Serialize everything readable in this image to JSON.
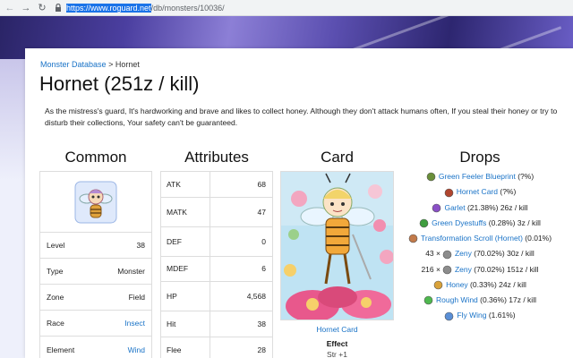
{
  "browser": {
    "url_selected": "https://www.roguard.net",
    "url_rest": "/db/monsters/10036/"
  },
  "breadcrumb": {
    "parent": "Monster Database",
    "separator": ">",
    "current": "Hornet"
  },
  "title": "Hornet (251z / kill)",
  "description": "As the mistress's guard, It's hardworking and brave and likes to collect honey. Although they don't attack humans often, If you steal their honey or try to disturb their collections, Your safety can't be guaranteed.",
  "headers": {
    "common": "Common",
    "attributes": "Attributes",
    "card": "Card",
    "drops": "Drops"
  },
  "common": [
    {
      "label": "Level",
      "value": "38",
      "link": false
    },
    {
      "label": "Type",
      "value": "Monster",
      "link": false
    },
    {
      "label": "Zone",
      "value": "Field",
      "link": false
    },
    {
      "label": "Race",
      "value": "Insect",
      "link": true
    },
    {
      "label": "Element",
      "value": "Wind",
      "link": true
    }
  ],
  "attributes": [
    {
      "label": "ATK",
      "value": "68"
    },
    {
      "label": "MATK",
      "value": "47"
    },
    {
      "label": "DEF",
      "value": "0"
    },
    {
      "label": "MDEF",
      "value": "6"
    },
    {
      "label": "HP",
      "value": "4,568"
    },
    {
      "label": "Hit",
      "value": "38"
    },
    {
      "label": "Flee",
      "value": "28"
    }
  ],
  "card": {
    "name": "Hornet Card",
    "effect_label": "Effect",
    "effect_value": "Str +1"
  },
  "drops": [
    {
      "prefix": "",
      "name": "Green Feeler Blueprint",
      "suffix": " (?%)",
      "icon": "blueprint-icon",
      "color": "#6a8f3a"
    },
    {
      "prefix": "",
      "name": "Hornet Card",
      "suffix": " (?%)",
      "icon": "card-icon",
      "color": "#b0452e"
    },
    {
      "prefix": "",
      "name": "Garlet",
      "suffix": " (21.38%) 26z / kill",
      "icon": "garlet-icon",
      "color": "#8a4fc6"
    },
    {
      "prefix": "",
      "name": "Green Dyestuffs",
      "suffix": " (0.28%) 3z / kill",
      "icon": "dyestuff-icon",
      "color": "#3f9d3f"
    },
    {
      "prefix": "",
      "name": "Transformation Scroll (Hornet)",
      "suffix": " (0.01%)",
      "icon": "scroll-icon",
      "color": "#c27a4a"
    },
    {
      "prefix": "43 ×",
      "name": "Zeny",
      "suffix": " (70.02%) 30z / kill",
      "icon": "zeny-icon",
      "color": "#8c8c8c"
    },
    {
      "prefix": "216 ×",
      "name": "Zeny",
      "suffix": " (70.02%) 151z / kill",
      "icon": "zeny-icon",
      "color": "#8c8c8c"
    },
    {
      "prefix": "",
      "name": "Honey",
      "suffix": " (0.33%) 24z / kill",
      "icon": "honey-icon",
      "color": "#d9a23a"
    },
    {
      "prefix": "",
      "name": "Rough Wind",
      "suffix": " (0.36%) 17z / kill",
      "icon": "rough-wind-icon",
      "color": "#4fb84f"
    },
    {
      "prefix": "",
      "name": "Fly Wing",
      "suffix": " (1.61%)",
      "icon": "fly-wing-icon",
      "color": "#5a8fd6"
    }
  ]
}
